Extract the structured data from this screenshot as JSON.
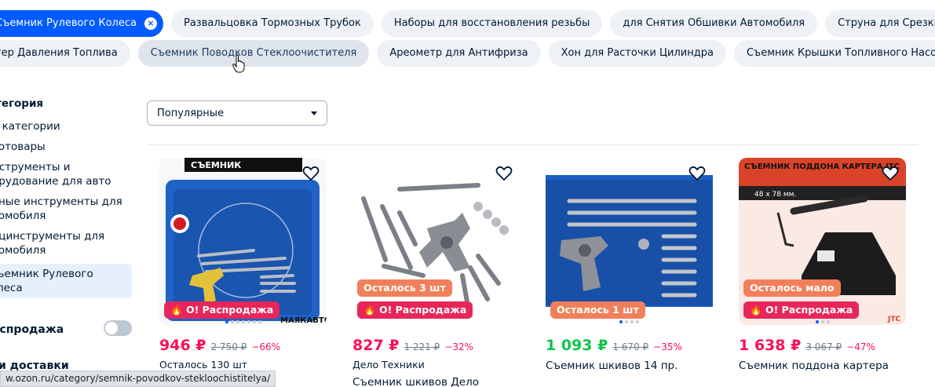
{
  "chips_row1": [
    {
      "label": "Съемник Рулевого Колеса",
      "active": true
    },
    {
      "label": "Развальцовка Тормозных Трубок"
    },
    {
      "label": "Наборы для восстановления резьбы"
    },
    {
      "label": "для Снятия Обшивки Автомобиля"
    },
    {
      "label": "Струна для Срезки Стекол"
    }
  ],
  "chips_row2": [
    {
      "label": "тер Давления Топлива"
    },
    {
      "label": "Съемник Поводков Стеклоочистителя",
      "hover": true
    },
    {
      "label": "Ареометр для Антифриза"
    },
    {
      "label": "Хон для Расточки Цилиндра"
    },
    {
      "label": "Съемник Крышки Топливного Насоса"
    }
  ],
  "sidebar": {
    "title": "тегория",
    "items": [
      "е категории",
      "тотовары",
      "нструменты и\nорудование для авто",
      "чные инструменты для\nтомобиля",
      "ецинструменты для\nтомобиля",
      "ъемник Рулевого\nлеса"
    ],
    "toggle_label": "аспродажа",
    "bottom_label": "и доставки"
  },
  "sort": {
    "value": "Популярные"
  },
  "products": [
    {
      "price": "946 ₽",
      "old": "2 750 ₽",
      "disc": "−66%",
      "sub": "Осталось 130 шт",
      "title": "",
      "left_badge": "",
      "sale_badge": "О! Распродажа",
      "green": false,
      "dots": 7
    },
    {
      "price": "827 ₽",
      "old": "1 221 ₽",
      "disc": "−32%",
      "sub": "Дело Техники",
      "title": "Съемник шкивов Дело",
      "left_badge": "Осталось 3 шт",
      "sale_badge": "О! Распродажа",
      "green": false,
      "dots": 0
    },
    {
      "price": "1 093 ₽",
      "old": "1 670 ₽",
      "disc": "−35%",
      "sub": "",
      "title": "Съемник шкивов 14 пр.",
      "left_badge": "Осталось 1 шт",
      "sale_badge": "",
      "green": true,
      "dots": 4
    },
    {
      "price": "1 638 ₽",
      "old": "3 067 ₽",
      "disc": "−47%",
      "sub": "",
      "title": "Съемник поддона картера",
      "left_badge": "Осталось мало",
      "sale_badge": "О! Распродажа",
      "green": false,
      "dots": 3
    }
  ],
  "image_text": {
    "p1_banner": "СЪЕМНИК",
    "p1_brand": "МАЯКАВТО",
    "p4_title": "СЪЕМНИК ПОДДОНА КАРТЕРА  JTC",
    "p4_size": "48 х 78 мм."
  },
  "status_url": "w.ozon.ru/category/semnik-povodkov-stekloochistitelya/"
}
